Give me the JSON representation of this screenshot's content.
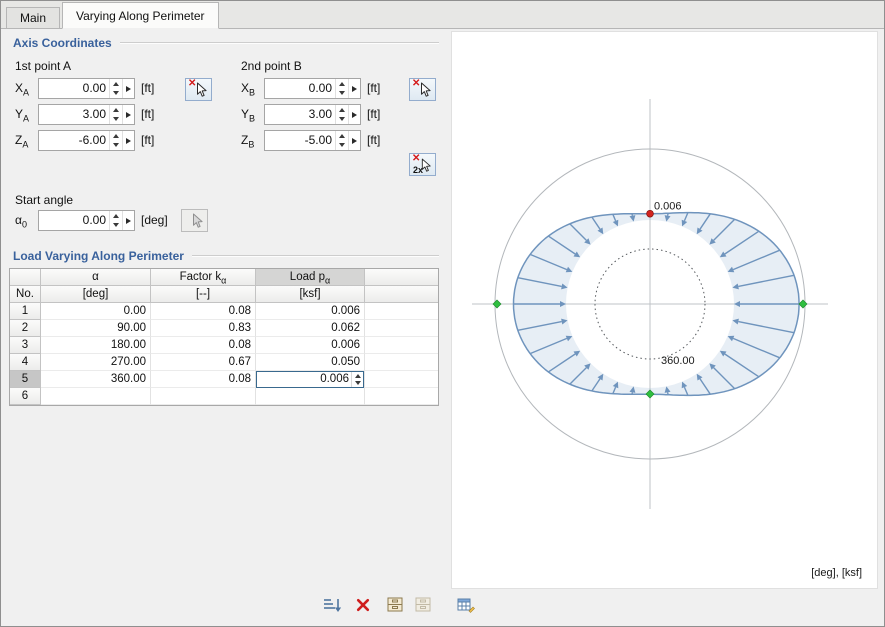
{
  "tabs": [
    {
      "label": "Main",
      "active": false
    },
    {
      "label": "Varying Along Perimeter",
      "active": true
    }
  ],
  "axis": {
    "title": "Axis Coordinates",
    "point_a_label": "1st point A",
    "point_b_label": "2nd point B",
    "fields_a": [
      {
        "sym": "X",
        "sub": "A",
        "value": "0.00",
        "unit": "[ft]"
      },
      {
        "sym": "Y",
        "sub": "A",
        "value": "3.00",
        "unit": "[ft]"
      },
      {
        "sym": "Z",
        "sub": "A",
        "value": "-6.00",
        "unit": "[ft]"
      }
    ],
    "fields_b": [
      {
        "sym": "X",
        "sub": "B",
        "value": "0.00",
        "unit": "[ft]"
      },
      {
        "sym": "Y",
        "sub": "B",
        "value": "3.00",
        "unit": "[ft]"
      },
      {
        "sym": "Z",
        "sub": "B",
        "value": "-5.00",
        "unit": "[ft]"
      }
    ],
    "pick_two_label": "2x",
    "start_angle_label": "Start angle",
    "start_angle": {
      "sym": "α",
      "sub": "0",
      "value": "0.00",
      "unit": "[deg]"
    }
  },
  "load_table": {
    "title": "Load Varying Along Perimeter",
    "header": {
      "no": "No.",
      "cols": [
        {
          "t": "α",
          "s": "",
          "u": "[deg]"
        },
        {
          "t": "Factor k",
          "s": "α",
          "u": "[--]"
        },
        {
          "t": "Load p",
          "s": "α",
          "u": "[ksf]"
        }
      ]
    },
    "rows": [
      {
        "no": "1",
        "alpha": "0.00",
        "factor": "0.08",
        "load": "0.006"
      },
      {
        "no": "2",
        "alpha": "90.00",
        "factor": "0.83",
        "load": "0.062"
      },
      {
        "no": "3",
        "alpha": "180.00",
        "factor": "0.08",
        "load": "0.006"
      },
      {
        "no": "4",
        "alpha": "270.00",
        "factor": "0.67",
        "load": "0.050"
      },
      {
        "no": "5",
        "alpha": "360.00",
        "factor": "0.08",
        "load": "0.006",
        "current": true,
        "editing": true
      },
      {
        "no": "6",
        "alpha": "",
        "factor": "",
        "load": ""
      }
    ]
  },
  "chart_data": {
    "type": "polar-load-distribution",
    "title": "Load varying along perimeter",
    "angles_deg": [
      0,
      90,
      180,
      270,
      360
    ],
    "factors_k": [
      0.08,
      0.83,
      0.08,
      0.67,
      0.08
    ],
    "loads_ksf": [
      0.006,
      0.062,
      0.006,
      0.05,
      0.006
    ],
    "selected_point": {
      "angle_deg": 360.0,
      "load_ksf": 0.006
    },
    "value_label": "0.006",
    "angle_label": "360.00",
    "units_label": "[deg], [ksf]",
    "colors": {
      "envelope": "#6f94bd",
      "selected_marker": "#d22420",
      "axis_markers": "#2fbf3f"
    }
  }
}
